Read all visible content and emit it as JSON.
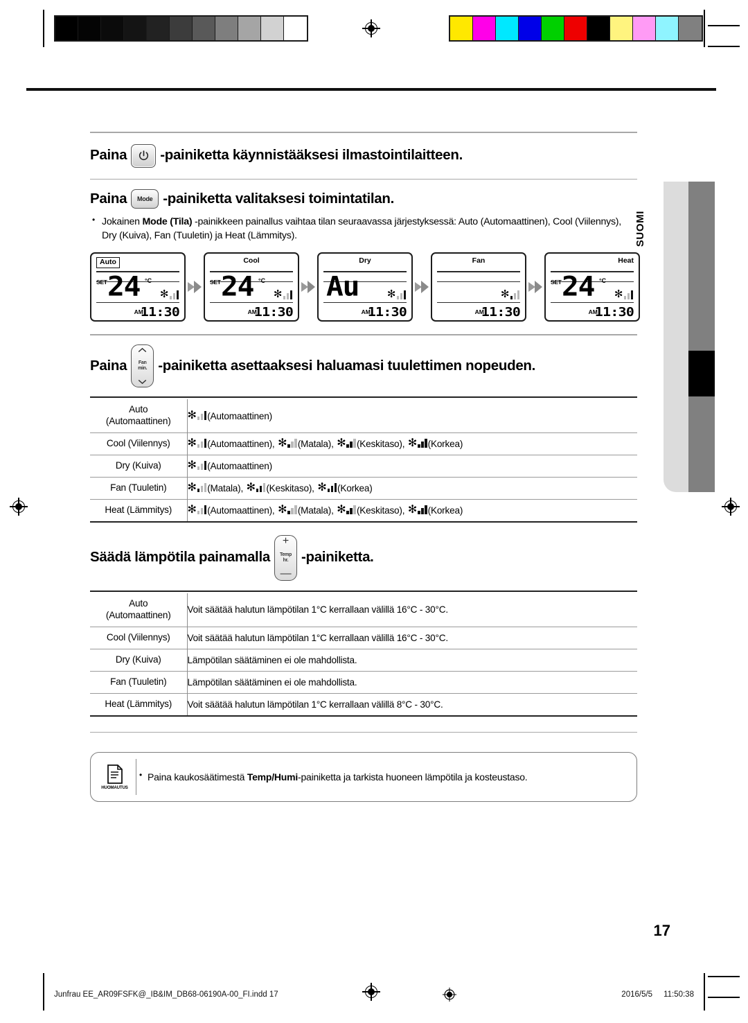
{
  "document": {
    "language_tab": "SUOMI",
    "page_number": "17",
    "footer_file": "Junfrau EE_AR09FSFK@_IB&IM_DB68-06190A-00_FI.indd   17",
    "footer_date": "2016/5/5",
    "footer_time": "11:50:38"
  },
  "calibration": {
    "grayscale": [
      "#000000",
      "#040404",
      "#0b0b0b",
      "#141414",
      "#222222",
      "#3c3c3c",
      "#595959",
      "#7e7e7e",
      "#a5a5a5",
      "#d2d2d2",
      "#ffffff"
    ],
    "colors": [
      "#ffe800",
      "#ff00e8",
      "#00e8ff",
      "#0000e8",
      "#00d000",
      "#ee0000",
      "#000000",
      "#fff47f",
      "#ff9bf5",
      "#8ff4ff",
      "#808080"
    ]
  },
  "sections": {
    "power": {
      "prefix": "Paina",
      "button_icon": "power-icon",
      "suffix": "-painiketta käynnistääksesi ilmastointilaitteen."
    },
    "mode": {
      "prefix": "Paina",
      "button_label": "Mode",
      "suffix": "-painiketta valitaksesi toimintatilan.",
      "bullet": {
        "lead": "Jokainen ",
        "bold": "Mode (Tila)",
        "rest": " -painikkeen painallus vaihtaa tilan seuraavassa järjestyksessä: Auto (Automaattinen), Cool (Viilennys), Dry (Kuiva), Fan (Tuuletin) ja Heat (Lämmitys)."
      }
    },
    "fan": {
      "prefix": "Paina",
      "button_top_icon": "chevron-up-icon",
      "button_label_line1": "Fan",
      "button_label_line2": "min.",
      "button_bottom_icon": "chevron-down-icon",
      "suffix": "-painiketta asettaaksesi haluamasi tuulettimen nopeuden."
    },
    "temp": {
      "prefix": "Säädä lämpötila painamalla",
      "button_plus": "+",
      "button_label_line1": "Temp",
      "button_label_line2": "hr.",
      "button_minus": "—",
      "suffix": "-painiketta."
    }
  },
  "lcd_panels": [
    {
      "mode_label": "Auto",
      "label_align": "left",
      "label_boxed": true,
      "set_label": "SET",
      "temp": "24",
      "unit": "°C",
      "show_temp": true,
      "big_text": "",
      "fan_bars": [
        "off",
        "off",
        "on"
      ],
      "am_label": "AM",
      "time": "11:30"
    },
    {
      "mode_label": "Cool",
      "label_align": "center",
      "label_boxed": false,
      "set_label": "SET",
      "temp": "24",
      "unit": "°C",
      "show_temp": true,
      "big_text": "",
      "fan_bars": [
        "off",
        "off",
        "on"
      ],
      "am_label": "AM",
      "time": "11:30"
    },
    {
      "mode_label": "Dry",
      "label_align": "center",
      "label_boxed": false,
      "set_label": "",
      "temp": "",
      "unit": "",
      "show_temp": false,
      "big_text": "Au",
      "fan_bars": [
        "off",
        "off",
        "on"
      ],
      "am_label": "AM",
      "time": "11:30"
    },
    {
      "mode_label": "Fan",
      "label_align": "center",
      "label_boxed": false,
      "set_label": "",
      "temp": "",
      "unit": "",
      "show_temp": false,
      "big_text": "",
      "fan_bars": [
        "on",
        "off",
        "off"
      ],
      "am_label": "AM",
      "time": "11:30"
    },
    {
      "mode_label": "Heat",
      "label_align": "right",
      "label_boxed": false,
      "set_label": "SET",
      "temp": "24",
      "unit": "°C",
      "show_temp": true,
      "big_text": "",
      "fan_bars": [
        "off",
        "off",
        "on"
      ],
      "am_label": "AM",
      "time": "11:30"
    }
  ],
  "fan_table": [
    {
      "mode_line1": "Auto",
      "mode_line2": "(Automaattinen)",
      "speeds": [
        {
          "label": "(Automaattinen)",
          "bars": [
            "off",
            "off",
            "on"
          ]
        }
      ]
    },
    {
      "mode_line1": "Cool (Viilennys)",
      "mode_line2": "",
      "speeds": [
        {
          "label": "(Automaattinen),",
          "bars": [
            "off",
            "off",
            "on"
          ]
        },
        {
          "label": "(Matala),",
          "bars": [
            "on",
            "off",
            "off"
          ]
        },
        {
          "label": "(Keskitaso),",
          "bars": [
            "on",
            "on",
            "off"
          ]
        },
        {
          "label": "(Korkea)",
          "bars": [
            "on",
            "on",
            "on"
          ]
        }
      ]
    },
    {
      "mode_line1": "Dry (Kuiva)",
      "mode_line2": "",
      "speeds": [
        {
          "label": "(Automaattinen)",
          "bars": [
            "off",
            "off",
            "on"
          ]
        }
      ]
    },
    {
      "mode_line1": "Fan (Tuuletin)",
      "mode_line2": "",
      "speeds": [
        {
          "label": "(Matala),",
          "bars": [
            "on",
            "off",
            "off"
          ]
        },
        {
          "label": "(Keskitaso),",
          "bars": [
            "on",
            "on",
            "off"
          ]
        },
        {
          "label": "(Korkea)",
          "bars": [
            "on",
            "on",
            "on"
          ]
        }
      ]
    },
    {
      "mode_line1": "Heat (Lämmitys)",
      "mode_line2": "",
      "speeds": [
        {
          "label": "(Automaattinen),",
          "bars": [
            "off",
            "off",
            "on"
          ]
        },
        {
          "label": "(Matala),",
          "bars": [
            "on",
            "off",
            "off"
          ]
        },
        {
          "label": "(Keskitaso),",
          "bars": [
            "on",
            "on",
            "off"
          ]
        },
        {
          "label": "(Korkea)",
          "bars": [
            "on",
            "on",
            "on"
          ]
        }
      ]
    }
  ],
  "temp_table": [
    {
      "mode_line1": "Auto",
      "mode_line2": "(Automaattinen)",
      "text": "Voit säätää halutun lämpötilan 1°C kerrallaan välillä 16°C - 30°C."
    },
    {
      "mode_line1": "Cool (Viilennys)",
      "mode_line2": "",
      "text": "Voit säätää halutun lämpötilan 1°C kerrallaan välillä 16°C - 30°C."
    },
    {
      "mode_line1": "Dry (Kuiva)",
      "mode_line2": "",
      "text": "Lämpötilan säätäminen ei ole mahdollista."
    },
    {
      "mode_line1": "Fan (Tuuletin)",
      "mode_line2": "",
      "text": "Lämpötilan säätäminen ei ole mahdollista."
    },
    {
      "mode_line1": "Heat (Lämmitys)",
      "mode_line2": "",
      "text": "Voit säätää halutun lämpötilan 1°C kerrallaan välillä 8°C - 30°C."
    }
  ],
  "note": {
    "icon_label": "HUOMAUTUS",
    "lead": "Paina kaukosäätimestä ",
    "bold": "Temp/Humi",
    "rest": "-painiketta ja tarkista huoneen lämpötila ja kosteustaso."
  }
}
